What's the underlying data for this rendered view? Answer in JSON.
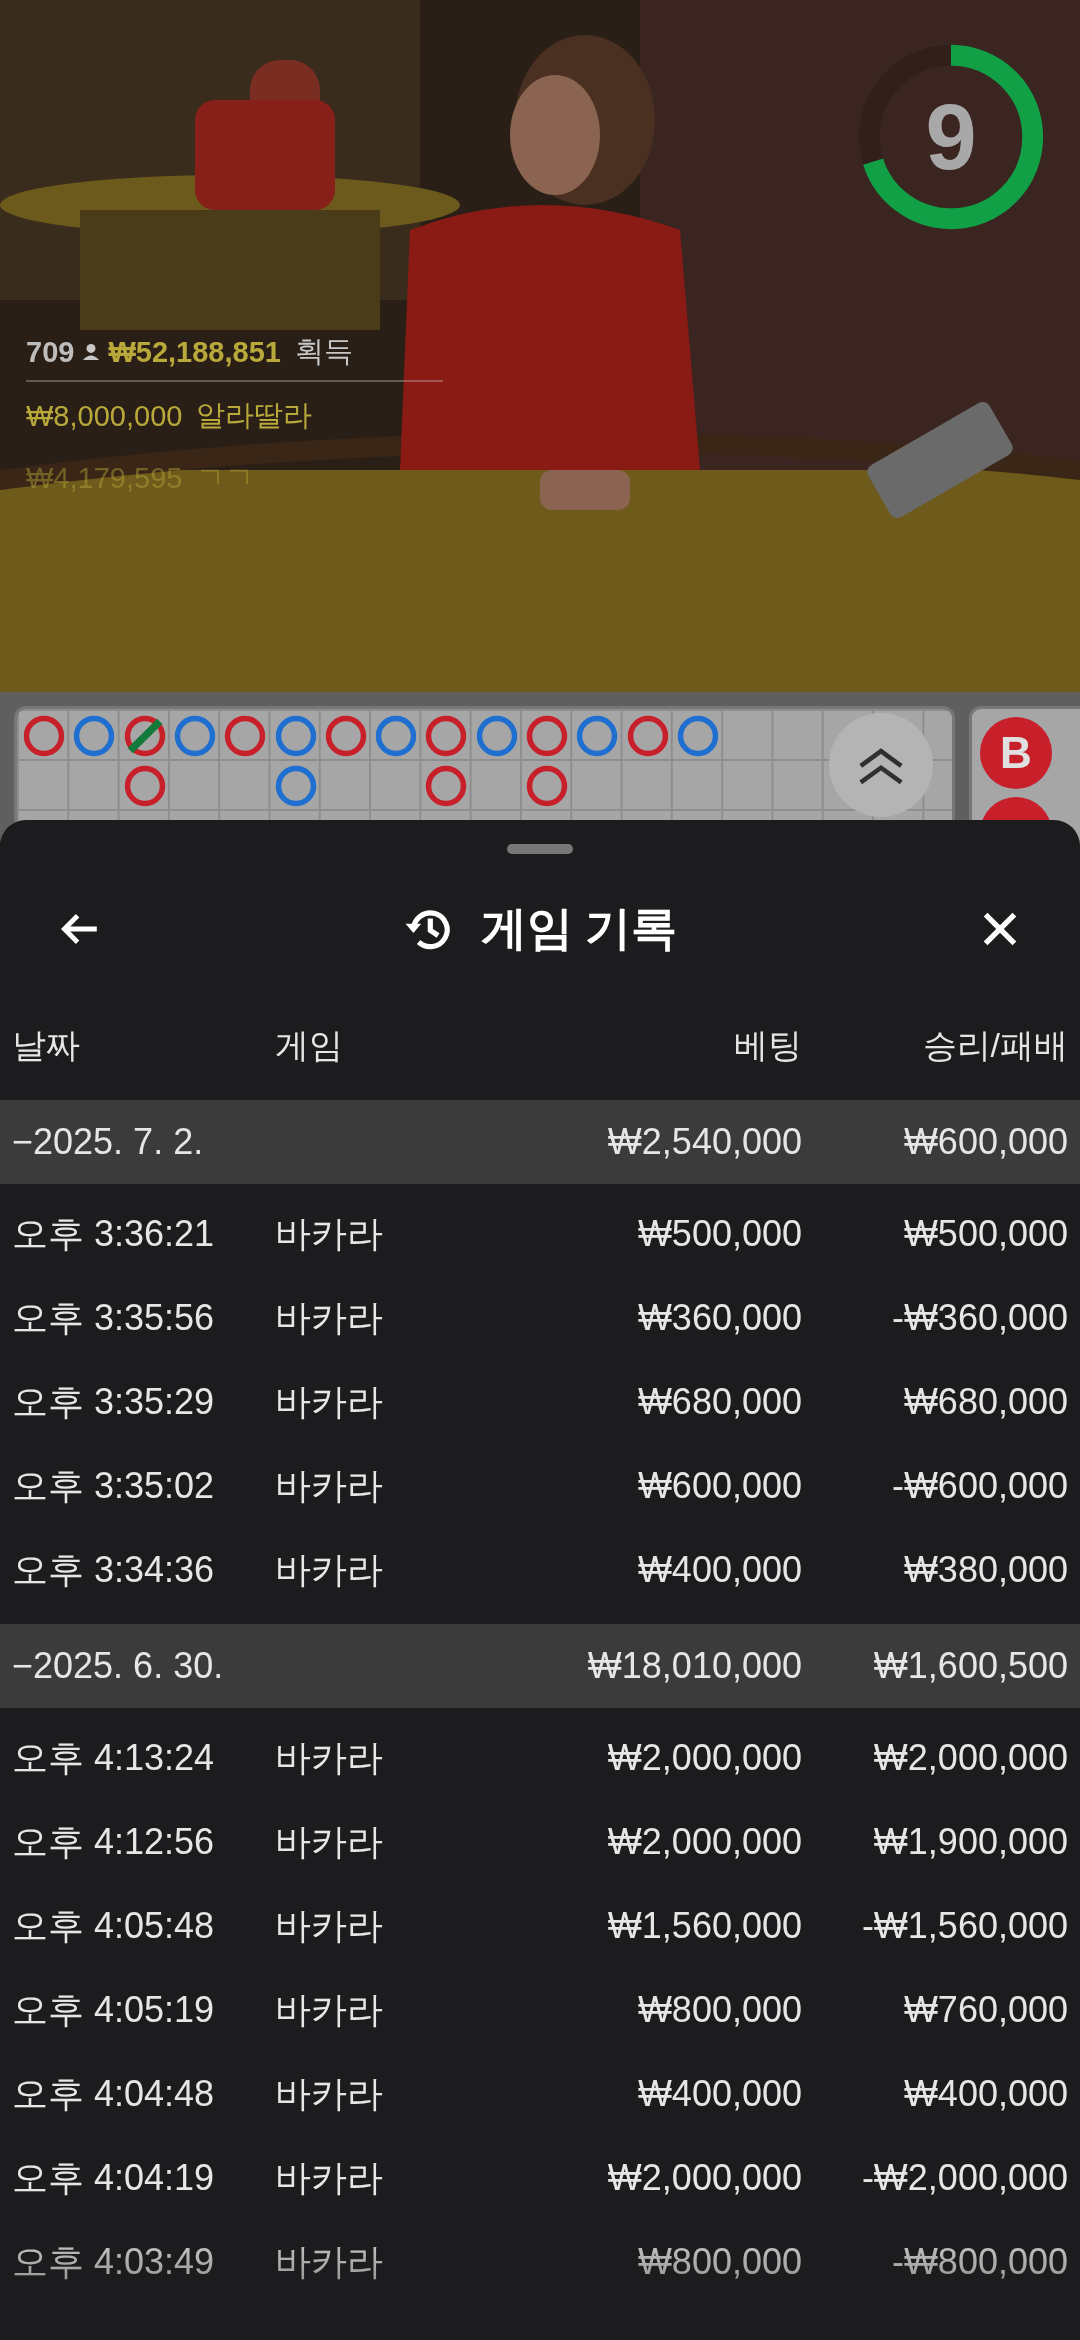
{
  "video": {
    "kind": "picture",
    "timer": {
      "value": "9",
      "level": 0.7
    },
    "winners": [
      {
        "count": "709",
        "amount": "₩52,188,851",
        "label": "획득"
      },
      {
        "amount": "₩8,000,000",
        "label": "알라딸라"
      },
      {
        "amount": "₩4,179,595",
        "label": "ㄱㄱ"
      }
    ]
  },
  "big_road": [
    [
      {
        "color": "#c8202a",
        "tie": false
      }
    ],
    [
      {
        "color": "#1f6fd1",
        "tie": false
      }
    ],
    [
      {
        "color": "#c8202a",
        "tie": true
      },
      {
        "color": "#c8202a",
        "tie": false
      }
    ],
    [
      {
        "color": "#1f6fd1",
        "tie": false
      }
    ],
    [
      {
        "color": "#c8202a",
        "tie": false
      }
    ],
    [
      {
        "color": "#1f6fd1",
        "tie": false
      },
      {
        "color": "#1f6fd1",
        "tie": false
      }
    ],
    [
      {
        "color": "#c8202a",
        "tie": false
      }
    ],
    [
      {
        "color": "#1f6fd1",
        "tie": false
      }
    ],
    [
      {
        "color": "#c8202a",
        "tie": false
      },
      {
        "color": "#c8202a",
        "tie": false
      }
    ],
    [
      {
        "color": "#1f6fd1",
        "tie": false
      }
    ],
    [
      {
        "color": "#c8202a",
        "tie": false
      },
      {
        "color": "#c8202a",
        "tie": false
      }
    ],
    [
      {
        "color": "#1f6fd1",
        "tie": false
      }
    ],
    [
      {
        "color": "#c8202a",
        "tie": false
      }
    ],
    [
      {
        "color": "#1f6fd1",
        "tie": false
      }
    ]
  ],
  "bead_road": [
    {
      "label": "B",
      "color": "#c8202a"
    }
  ],
  "history": {
    "title": "게임 기록",
    "columns": [
      "날짜",
      "게임",
      "베팅",
      "승리/패배"
    ],
    "groups": [
      {
        "date": "−2025. 7. 2.",
        "bet": "₩2,540,000",
        "result": "₩600,000",
        "rows": [
          {
            "time": "오후 3:36:21",
            "game": "바카라",
            "bet": "₩500,000",
            "result": "₩500,000"
          },
          {
            "time": "오후 3:35:56",
            "game": "바카라",
            "bet": "₩360,000",
            "result": "-₩360,000"
          },
          {
            "time": "오후 3:35:29",
            "game": "바카라",
            "bet": "₩680,000",
            "result": "₩680,000"
          },
          {
            "time": "오후 3:35:02",
            "game": "바카라",
            "bet": "₩600,000",
            "result": "-₩600,000"
          },
          {
            "time": "오후 3:34:36",
            "game": "바카라",
            "bet": "₩400,000",
            "result": "₩380,000"
          }
        ]
      },
      {
        "date": "−2025. 6. 30.",
        "bet": "₩18,010,000",
        "result": "₩1,600,500",
        "rows": [
          {
            "time": "오후 4:13:24",
            "game": "바카라",
            "bet": "₩2,000,000",
            "result": "₩2,000,000"
          },
          {
            "time": "오후 4:12:56",
            "game": "바카라",
            "bet": "₩2,000,000",
            "result": "₩1,900,000"
          },
          {
            "time": "오후 4:05:48",
            "game": "바카라",
            "bet": "₩1,560,000",
            "result": "-₩1,560,000"
          },
          {
            "time": "오후 4:05:19",
            "game": "바카라",
            "bet": "₩800,000",
            "result": "₩760,000"
          },
          {
            "time": "오후 4:04:48",
            "game": "바카라",
            "bet": "₩400,000",
            "result": "₩400,000"
          },
          {
            "time": "오후 4:04:19",
            "game": "바카라",
            "bet": "₩2,000,000",
            "result": "-₩2,000,000"
          },
          {
            "time": "오후 4:03:49",
            "game": "바카라",
            "bet": "₩800,000",
            "result": "-₩800,000"
          }
        ]
      }
    ]
  }
}
